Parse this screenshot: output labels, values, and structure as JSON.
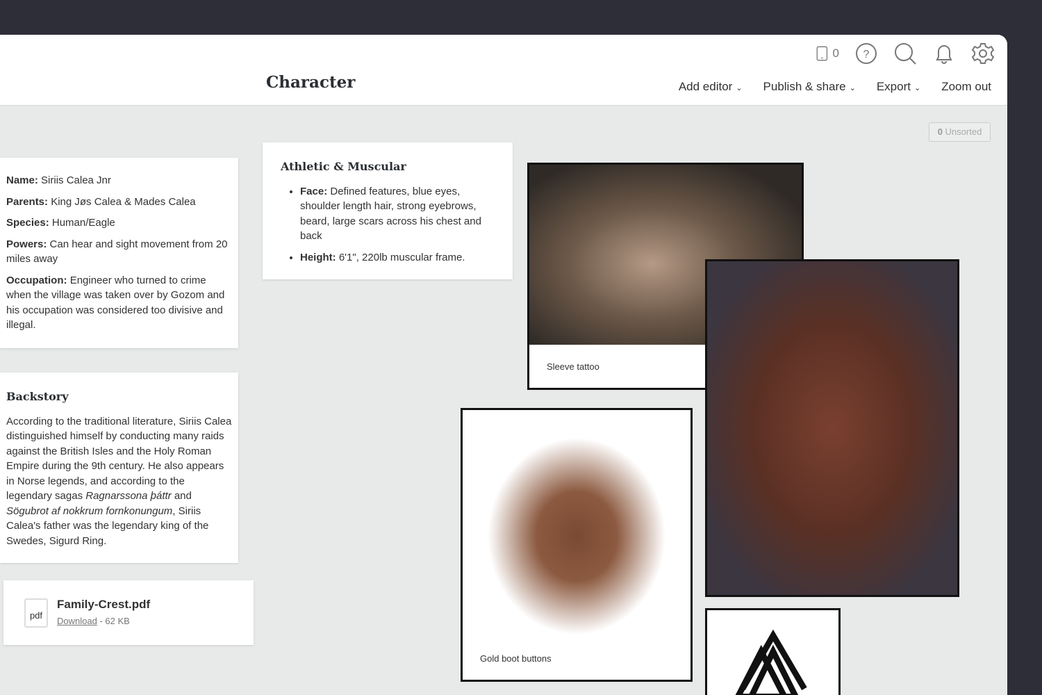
{
  "header": {
    "title": "Character",
    "device_count": "0",
    "menu": [
      "Add editor",
      "Publish & share",
      "Export",
      "Zoom out"
    ]
  },
  "unsorted": {
    "count": "0",
    "label": "Unsorted"
  },
  "info": [
    {
      "k": "Name:",
      "v": "Siriis Calea Jnr"
    },
    {
      "k": "Parents:",
      "v": "King Jøs Calea & Mades Calea"
    },
    {
      "k": "Species:",
      "v": "Human/Eagle"
    },
    {
      "k": "Powers:",
      "v": "Can hear and sight movement from 20 miles away"
    },
    {
      "k": "Occupation:",
      "v": "Engineer who turned to crime when the village was taken over by Gozom and his occupation was considered too divisive and illegal."
    }
  ],
  "athletic": {
    "title": "Athletic & Muscular",
    "items": [
      {
        "k": "Face:",
        "v": "Defined features, blue eyes, shoulder length hair, strong eyebrows, beard, large scars across his chest and back"
      },
      {
        "k": "Height:",
        "v": "6'1\", 220lb muscular frame."
      }
    ]
  },
  "backstory": {
    "title": "Backstory",
    "t1": "According to the traditional literature, Siriis Calea distinguished himself by conducting many raids against the British Isles and the Holy Roman Empire during the 9th century. He also appears in Norse legends, and according to the legendary sagas ",
    "i1": "Ragnarssona þáttr",
    "t2": " and ",
    "i2": "Sögubrot af nokkrum fornkonungum",
    "t3": ", Siriis Calea's father was the legendary king of the Swedes, Sigurd Ring."
  },
  "file": {
    "name": "Family-Crest.pdf",
    "ext": "pdf",
    "download": "Download",
    "size": " - 62 KB"
  },
  "images": {
    "tattoo": "Sleeve tattoo",
    "boots": "Gold boot buttons"
  }
}
